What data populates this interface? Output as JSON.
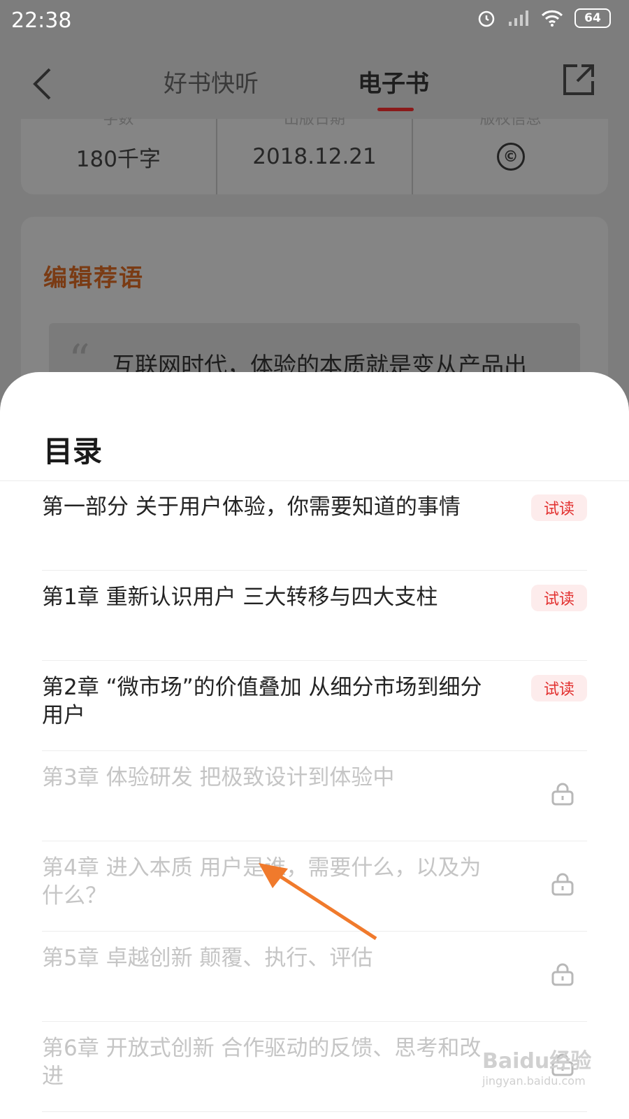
{
  "status": {
    "time": "22:38",
    "battery": "64"
  },
  "nav": {
    "tabs": [
      "好书快听",
      "电子书"
    ]
  },
  "info": {
    "labels": [
      "字数",
      "出版日期",
      "版权信息"
    ],
    "values": [
      "180千字",
      "2018.12.21"
    ],
    "copyright_glyph": "©"
  },
  "editor": {
    "title": "编辑荐语",
    "quote": "互联网时代，体验的本质就是变从产品出"
  },
  "sheet": {
    "title": "目录",
    "trial_label": "试读",
    "items": [
      {
        "text": "第一部分 关于用户体验，你需要知道的事情",
        "status": "trial"
      },
      {
        "text": "第1章 重新认识用户 三大转移与四大支柱",
        "status": "trial"
      },
      {
        "text": "第2章 “微市场”的价值叠加 从细分市场到细分用户",
        "status": "trial"
      },
      {
        "text": "第3章 体验研发 把极致设计到体验中",
        "status": "locked"
      },
      {
        "text": "第4章 进入本质 用户是谁，需要什么，以及为什么？",
        "status": "locked"
      },
      {
        "text": "第5章 卓越创新 颠覆、执行、评估",
        "status": "locked"
      },
      {
        "text": "第6章 开放式创新 合作驱动的反馈、思考和改进",
        "status": "locked"
      }
    ]
  },
  "watermark": {
    "main": "Baidu经验",
    "sub": "jingyan.baidu.com"
  },
  "colors": {
    "accent": "#e2302f",
    "arrow": "#f07a2c",
    "locked_text": "#c5c5c5"
  }
}
